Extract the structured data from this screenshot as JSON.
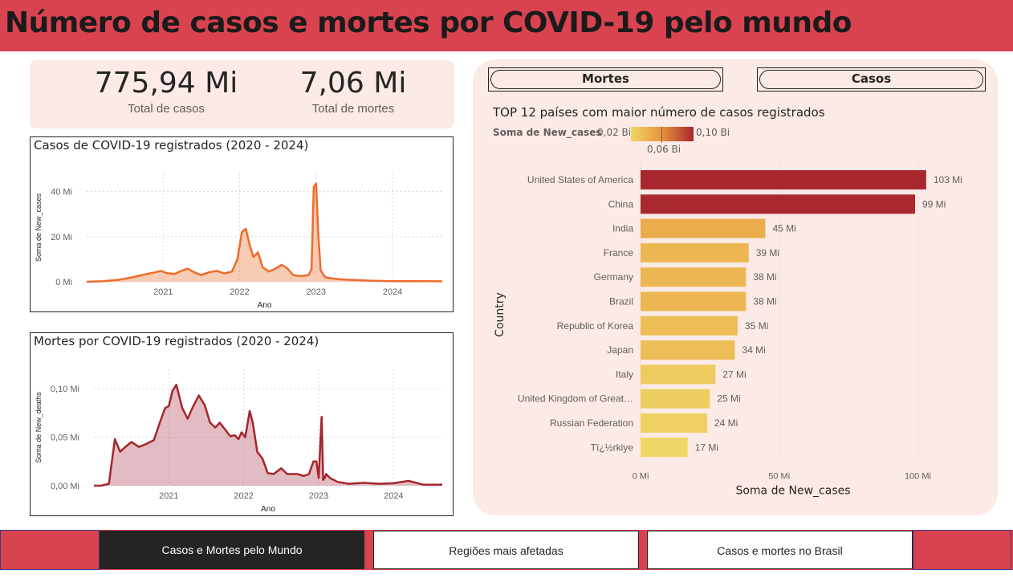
{
  "header": {
    "title": "Número de casos e mortes por COVID-19 pelo mundo"
  },
  "kpis": [
    {
      "value": "775,94 Mi",
      "label": "Total de casos"
    },
    {
      "value": "7,06 Mi",
      "label": "Total de mortes"
    }
  ],
  "toggles": {
    "deaths_label": "Mortes",
    "cases_label": "Casos"
  },
  "colors": {
    "header": "#d9434f",
    "panel": "#fbeae5",
    "cases_line": "#ee6b2b",
    "deaths_line": "#a4262c"
  },
  "chart_data": [
    {
      "type": "area",
      "title": "Casos de COVID-19 registrados (2020 - 2024)",
      "xlabel": "Ano",
      "ylabel": "Soma de New_cases",
      "ytick_labels": [
        "0 Mi",
        "20 Mi",
        "40 Mi"
      ],
      "yticks": [
        0,
        20,
        40
      ],
      "xtick_labels": [
        "2021",
        "2022",
        "2023",
        "2024"
      ],
      "ylim": [
        0,
        48
      ],
      "xlim": [
        2020.0,
        2024.65
      ],
      "grid": true,
      "x": [
        2020.0,
        2020.2,
        2020.4,
        2020.6,
        2020.75,
        2020.9,
        2020.97,
        2021.05,
        2021.15,
        2021.25,
        2021.32,
        2021.4,
        2021.5,
        2021.6,
        2021.7,
        2021.8,
        2021.9,
        2021.97,
        2022.03,
        2022.08,
        2022.13,
        2022.18,
        2022.24,
        2022.3,
        2022.38,
        2022.45,
        2022.55,
        2022.62,
        2022.7,
        2022.8,
        2022.9,
        2022.94,
        2022.97,
        2023.0,
        2023.03,
        2023.06,
        2023.12,
        2023.2,
        2023.35,
        2023.5,
        2023.7,
        2024.0,
        2024.3,
        2024.65
      ],
      "values": [
        0,
        0.2,
        0.8,
        2.0,
        3.2,
        4.2,
        4.8,
        3.8,
        3.5,
        5.0,
        5.8,
        4.3,
        3.0,
        4.2,
        4.8,
        3.7,
        4.5,
        10.0,
        22.0,
        23.5,
        16.5,
        11.0,
        13.0,
        6.5,
        4.5,
        5.5,
        7.5,
        6.0,
        3.0,
        2.5,
        3.0,
        5.5,
        42.0,
        43.5,
        20.0,
        5.0,
        2.0,
        1.5,
        1.0,
        0.8,
        0.5,
        0.3,
        0.3,
        0.2
      ]
    },
    {
      "type": "area",
      "title": "Mortes por COVID-19 registrados (2020 - 2024)",
      "xlabel": "Ano",
      "ylabel": "Soma de New_deaths",
      "ytick_labels": [
        "0,00 Mi",
        "0,05 Mi",
        "0,10 Mi"
      ],
      "yticks": [
        0,
        0.05,
        0.1
      ],
      "xtick_labels": [
        "2021",
        "2022",
        "2023",
        "2024"
      ],
      "ylim": [
        0,
        0.12
      ],
      "xlim": [
        2020.0,
        2024.65
      ],
      "grid": true,
      "x": [
        2020.0,
        2020.1,
        2020.2,
        2020.28,
        2020.35,
        2020.42,
        2020.5,
        2020.6,
        2020.7,
        2020.8,
        2020.88,
        2020.95,
        2021.0,
        2021.05,
        2021.1,
        2021.18,
        2021.25,
        2021.32,
        2021.4,
        2021.48,
        2021.55,
        2021.62,
        2021.68,
        2021.75,
        2021.82,
        2021.88,
        2021.93,
        2021.97,
        2022.02,
        2022.08,
        2022.12,
        2022.18,
        2022.25,
        2022.32,
        2022.4,
        2022.5,
        2022.58,
        2022.65,
        2022.72,
        2022.8,
        2022.87,
        2022.93,
        2022.97,
        2023.0,
        2023.04,
        2023.06,
        2023.08,
        2023.1,
        2023.15,
        2023.25,
        2023.4,
        2023.6,
        2023.8,
        2024.0,
        2024.2,
        2024.4,
        2024.65
      ],
      "values": [
        0,
        0.0,
        0.002,
        0.048,
        0.035,
        0.04,
        0.045,
        0.04,
        0.043,
        0.047,
        0.065,
        0.08,
        0.082,
        0.098,
        0.104,
        0.08,
        0.069,
        0.081,
        0.093,
        0.083,
        0.065,
        0.06,
        0.065,
        0.058,
        0.051,
        0.052,
        0.048,
        0.055,
        0.05,
        0.077,
        0.065,
        0.035,
        0.028,
        0.013,
        0.012,
        0.018,
        0.012,
        0.012,
        0.012,
        0.01,
        0.012,
        0.025,
        0.025,
        0.008,
        0.071,
        0.006,
        0.008,
        0.012,
        0.008,
        0.004,
        0.002,
        0.003,
        0.002,
        0.0025,
        0.005,
        0.001,
        0.001
      ]
    },
    {
      "type": "bar",
      "orientation": "horizontal",
      "title": "TOP 12 países com maior número de casos registrados",
      "xlabel": "Soma de New_cases",
      "ylabel": "Country",
      "legend_title": "Soma de New_cases",
      "legend_min_label": "0,02 Bi",
      "legend_mid_label": "0,06 Bi",
      "legend_max_label": "0,10 Bi",
      "xtick_labels": [
        "0 Mi",
        "50 Mi",
        "100 Mi"
      ],
      "xticks": [
        0,
        50,
        100
      ],
      "xlim": [
        0,
        110
      ],
      "grid": true,
      "categories": [
        "United States of America",
        "China",
        "India",
        "France",
        "Germany",
        "Brazil",
        "Republic of Korea",
        "Japan",
        "Italy",
        "United Kingdom of Great…",
        "Russian Federation",
        "Tï¿½rkiye"
      ],
      "values": [
        103,
        99,
        45,
        39,
        38,
        38,
        35,
        34,
        27,
        25,
        24,
        17
      ],
      "value_labels": [
        "103 Mi",
        "99 Mi",
        "45 Mi",
        "39 Mi",
        "38 Mi",
        "38 Mi",
        "35 Mi",
        "34 Mi",
        "27 Mi",
        "25 Mi",
        "24 Mi",
        "17 Mi"
      ]
    }
  ],
  "nav": {
    "items": [
      "Casos e Mortes pelo Mundo",
      "Regiões mais afetadas",
      "Casos e mortes no Brasil"
    ],
    "active_index": 0
  }
}
